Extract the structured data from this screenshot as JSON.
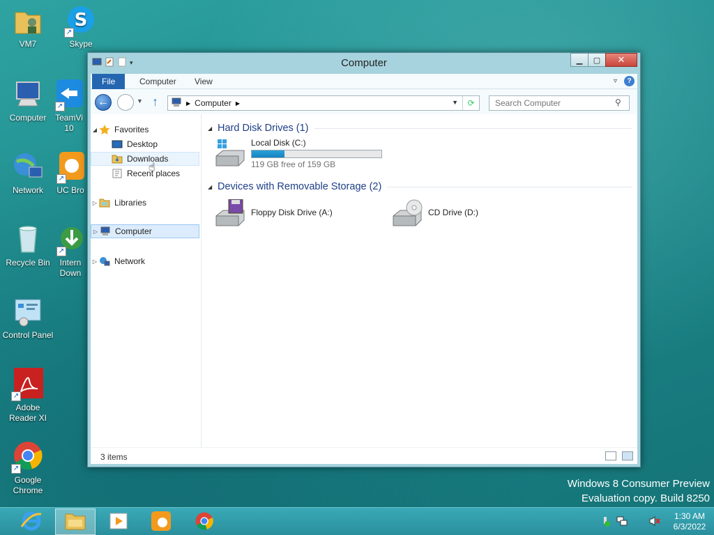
{
  "desktop": {
    "icons": [
      {
        "label": "VM7"
      },
      {
        "label": "Skype"
      },
      {
        "label": "Computer"
      },
      {
        "label": "TeamVi 10"
      },
      {
        "label": "Network"
      },
      {
        "label": "UC Bro"
      },
      {
        "label": "Recycle Bin"
      },
      {
        "label": "Intern Down"
      },
      {
        "label": "Control Panel"
      },
      {
        "label": "Adobe Reader XI"
      },
      {
        "label": "Google Chrome"
      }
    ]
  },
  "watermark": {
    "line1": "Windows 8 Consumer Preview",
    "line2": "Evaluation copy. Build 8250"
  },
  "window": {
    "title": "Computer",
    "ribbon_tabs": [
      "File",
      "Computer",
      "View"
    ],
    "address": "Computer",
    "search_placeholder": "Search Computer",
    "nav": {
      "favorites": "Favorites",
      "desktop": "Desktop",
      "downloads": "Downloads",
      "recent": "Recent places",
      "libraries": "Libraries",
      "computer": "Computer",
      "network": "Network"
    },
    "groups": {
      "hdd": "Hard Disk Drives (1)",
      "removable": "Devices with Removable Storage (2)"
    },
    "drives": {
      "c_name": "Local Disk (C:)",
      "c_free": "119 GB free of 159 GB",
      "c_used_fraction": 0.25,
      "a_name": "Floppy Disk Drive (A:)",
      "d_name": "CD Drive (D:)"
    },
    "status": "3 items"
  },
  "taskbar": {
    "time": "1:30 AM",
    "date": "6/3/2022"
  },
  "colors": {
    "accent": "#2466b0",
    "desktop": "#1f8a8c",
    "usage_bar": "#1683c2"
  }
}
